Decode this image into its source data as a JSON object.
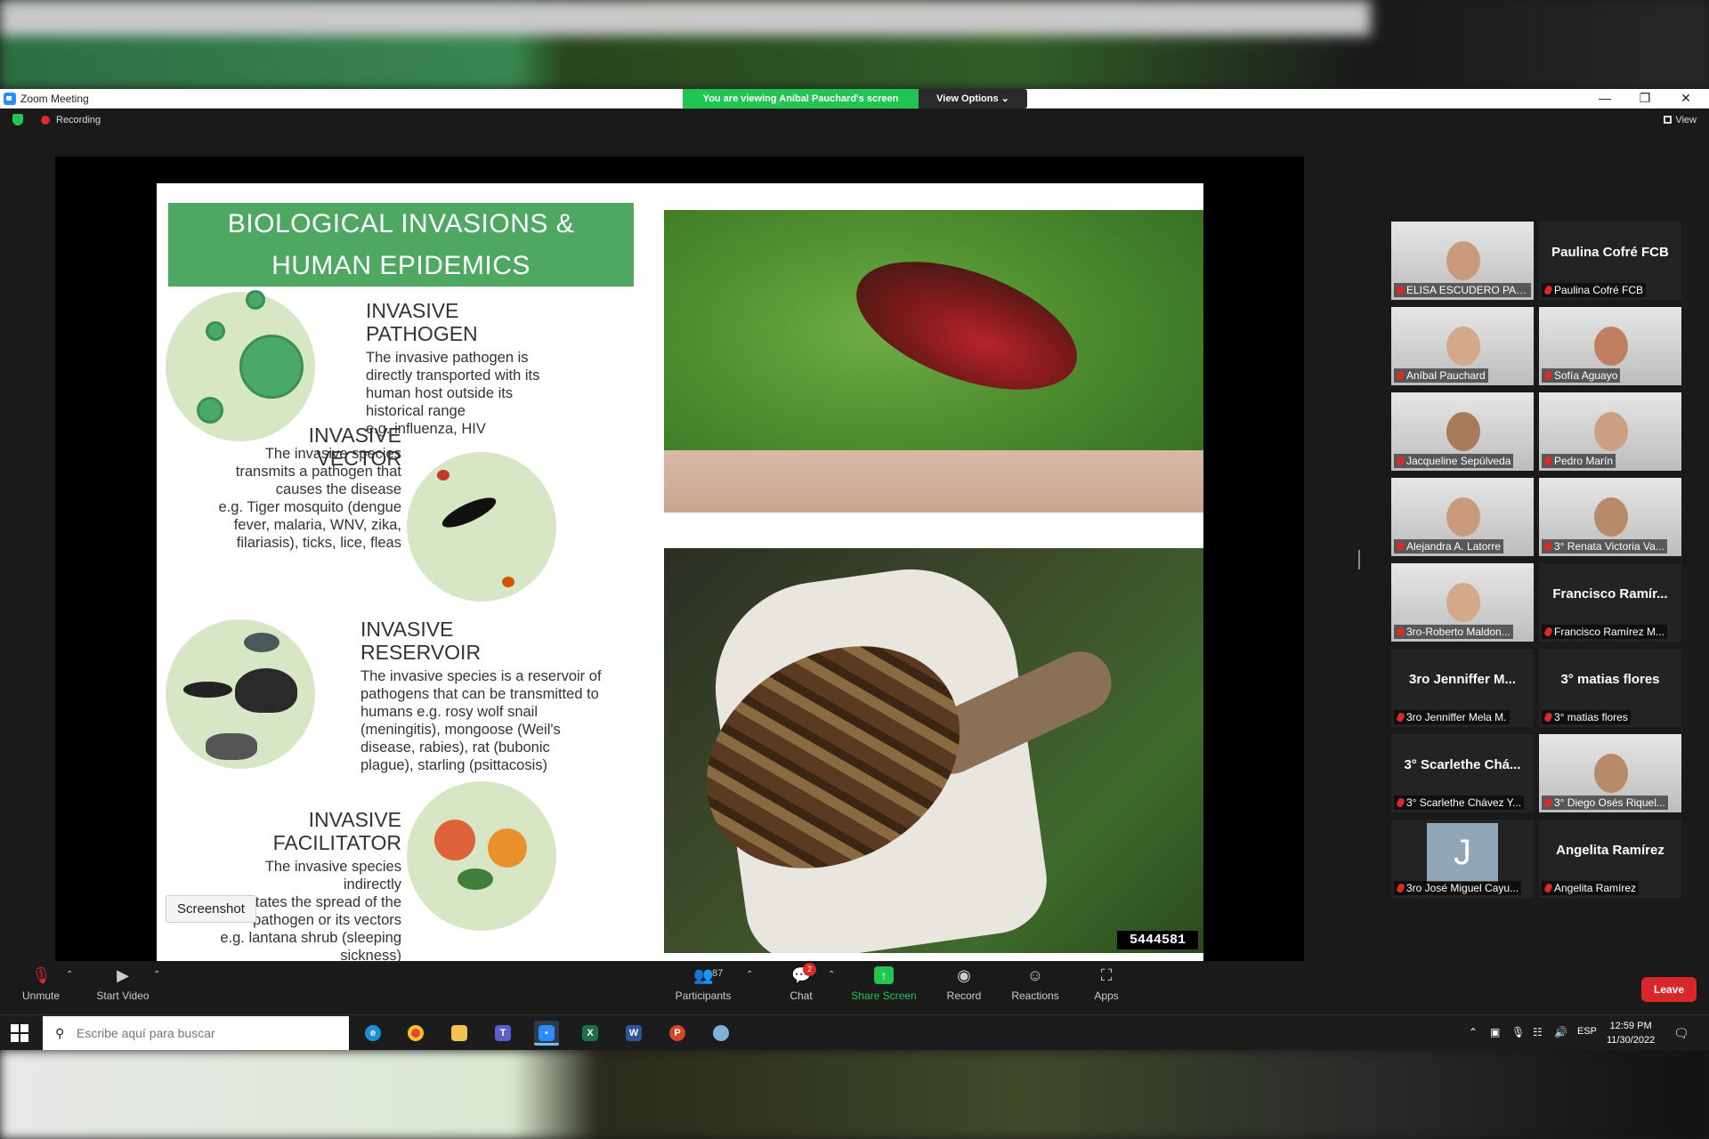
{
  "window": {
    "title": "Zoom Meeting",
    "viewing_banner": "You are viewing Aníbal Pauchard's screen",
    "view_options": "View Options ⌄",
    "minimize": "—",
    "restore": "❐",
    "close": "✕"
  },
  "status": {
    "recording": "Recording",
    "view": "View"
  },
  "slide": {
    "title_line1": "BIOLOGICAL INVASIONS &",
    "title_line2": "HUMAN EPIDEMICS",
    "sections": [
      {
        "title_line1": "INVASIVE",
        "title_line2": "PATHOGEN",
        "text": [
          "The invasive pathogen is",
          "directly transported with its",
          "human host outside its",
          "historical range",
          "e.g. influenza, HIV"
        ]
      },
      {
        "title_line1": "INVASIVE VECTOR",
        "title_line2": "",
        "text": [
          "The invasive species",
          "transmits a pathogen that",
          "causes the disease",
          "e.g. Tiger mosquito (dengue",
          "fever, malaria, WNV, zika,",
          "filariasis), ticks, lice, fleas"
        ]
      },
      {
        "title_line1": "INVASIVE",
        "title_line2": "RESERVOIR",
        "text": [
          "The invasive species is a reservoir of",
          "pathogens that can be transmitted to",
          "humans e.g. rosy wolf snail",
          "(meningitis), mongoose (Weil's",
          "disease, rabies), rat (bubonic",
          "plague), starling (psittacosis)"
        ]
      },
      {
        "title_line1": "INVASIVE",
        "title_line2": "FACILITATOR",
        "text": [
          "The invasive species indirectly",
          "facilitates the spread of the",
          "pathogen or its vectors",
          "e.g. lantana shrub (sleeping",
          "sickness)"
        ]
      }
    ],
    "image_id": "5444581",
    "screenshot_tooltip": "Screenshot"
  },
  "participants_gallery": [
    {
      "name": "ELISA ESCUDERO PAS...",
      "big_name": "",
      "video": true,
      "active": false
    },
    {
      "name": "Paulina Cofré FCB",
      "big_name": "Paulina Cofré FCB",
      "video": false,
      "active": false
    },
    {
      "name": "Aníbal Pauchard",
      "big_name": "",
      "video": true,
      "active": true
    },
    {
      "name": "Sofía Aguayo",
      "big_name": "",
      "video": true,
      "active": false
    },
    {
      "name": "Jacqueline Sepúlveda",
      "big_name": "",
      "video": true,
      "active": false
    },
    {
      "name": "Pedro Marín",
      "big_name": "",
      "video": true,
      "active": false
    },
    {
      "name": "Alejandra A. Latorre",
      "big_name": "",
      "video": true,
      "active": false
    },
    {
      "name": "3° Renata Victoria Va...",
      "big_name": "",
      "video": true,
      "active": false
    },
    {
      "name": "3ro-Roberto Maldon...",
      "big_name": "",
      "video": true,
      "active": false
    },
    {
      "name": "Francisco Ramírez M...",
      "big_name": "Francisco Ramír...",
      "video": false,
      "active": false
    },
    {
      "name": "3ro Jenniffer Mela M.",
      "big_name": "3ro Jenniffer M...",
      "video": false,
      "active": false
    },
    {
      "name": "3° matias flores",
      "big_name": "3° matias flores",
      "video": false,
      "active": false
    },
    {
      "name": "3° Scarlethe Chávez Y...",
      "big_name": "3° Scarlethe Chá...",
      "video": false,
      "active": false
    },
    {
      "name": "3° Diego Osés Riquel...",
      "big_name": "",
      "video": true,
      "active": false
    },
    {
      "name": "3ro José Miguel Cayu...",
      "big_name": "",
      "video": false,
      "avatar_letter": "J",
      "active": false
    },
    {
      "name": "Angelita Ramírez",
      "big_name": "Angelita Ramírez",
      "video": false,
      "active": false
    }
  ],
  "toolbar": {
    "unmute": "Unmute",
    "start_video": "Start Video",
    "participants": "Participants",
    "participants_count": "87",
    "chat": "Chat",
    "chat_badge": "2",
    "share_screen": "Share Screen",
    "record": "Record",
    "reactions": "Reactions",
    "apps": "Apps",
    "leave": "Leave"
  },
  "taskbar": {
    "search_placeholder": "Escribe aquí para buscar",
    "language": "ESP",
    "time": "12:59 PM",
    "date": "11/30/2022"
  },
  "colors": {
    "zoom_blue": "#2d8cff",
    "banner_green": "#23c552",
    "slide_green": "#4ea862",
    "leave_red": "#d9262b",
    "active_speaker": "#c8e35a"
  }
}
